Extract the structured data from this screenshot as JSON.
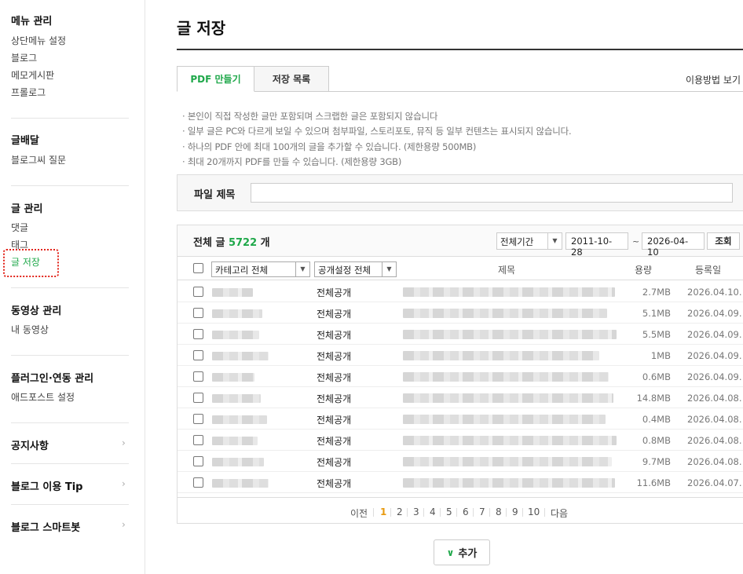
{
  "sidebar": {
    "sections": [
      {
        "title": "메뉴 관리",
        "items": [
          "상단메뉴 설정",
          "블로그",
          "메모게시판",
          "프롤로그"
        ]
      },
      {
        "title": "글배달",
        "items": [
          "블로그씨 질문"
        ]
      },
      {
        "title": "글 관리",
        "items": [
          "댓글",
          "태그",
          "글 저장"
        ]
      },
      {
        "title": "동영상 관리",
        "items": [
          "내 동영상"
        ]
      },
      {
        "title": "플러그인·연동 관리",
        "items": [
          "애드포스트 설정"
        ]
      }
    ],
    "links": [
      "공지사항",
      "블로그 이용 Tip",
      "블로그 스마트봇"
    ],
    "active_item": "글 저장"
  },
  "page": {
    "title": "글 저장",
    "tabs": [
      "PDF 만들기",
      "저장 목록"
    ],
    "help_link": "이용방법 보기",
    "notes": [
      "본인이 직접 작성한 글만 포함되며 스크랩한 글은 포함되지 않습니다",
      "일부 글은 PC와 다르게 보일 수 있으며 첨부파일, 스토리포토, 뮤직 등 일부 컨텐츠는 표시되지 않습니다.",
      "하나의 PDF 안에 최대 100개의 글을 추가할 수 있습니다. (제한용량 500MB)",
      "최대 20개까지 PDF를 만들 수 있습니다. (제한용량 3GB)"
    ],
    "file_title_label": "파일 제목",
    "file_title_value": ""
  },
  "list": {
    "title_prefix": "전체 글",
    "count": "5722",
    "title_suffix": "개",
    "period_select": "전체기간",
    "date_from": "2011-10-28",
    "date_sep": "~",
    "date_to": "2026-04-10",
    "search_button": "조회",
    "category_select": "카테고리 전체",
    "visibility_select": "공개설정 전체",
    "col_title": "제목",
    "col_size": "용량",
    "col_date": "등록일",
    "rows": [
      {
        "visibility": "전체공개",
        "size": "2.7MB",
        "date": "2026.04.10."
      },
      {
        "visibility": "전체공개",
        "size": "5.1MB",
        "date": "2026.04.09."
      },
      {
        "visibility": "전체공개",
        "size": "5.5MB",
        "date": "2026.04.09."
      },
      {
        "visibility": "전체공개",
        "size": "1MB",
        "date": "2026.04.09."
      },
      {
        "visibility": "전체공개",
        "size": "0.6MB",
        "date": "2026.04.09."
      },
      {
        "visibility": "전체공개",
        "size": "14.8MB",
        "date": "2026.04.08."
      },
      {
        "visibility": "전체공개",
        "size": "0.4MB",
        "date": "2026.04.08."
      },
      {
        "visibility": "전체공개",
        "size": "0.8MB",
        "date": "2026.04.08."
      },
      {
        "visibility": "전체공개",
        "size": "9.7MB",
        "date": "2026.04.08."
      },
      {
        "visibility": "전체공개",
        "size": "11.6MB",
        "date": "2026.04.07."
      }
    ]
  },
  "pagination": {
    "prev": "이전",
    "pages": [
      "1",
      "2",
      "3",
      "4",
      "5",
      "6",
      "7",
      "8",
      "9",
      "10"
    ],
    "current": "1",
    "next": "다음"
  },
  "add_button": "추가",
  "colors": {
    "accent": "#1fa84a",
    "current_page": "#e89a10",
    "highlight_box": "#e2231a"
  }
}
